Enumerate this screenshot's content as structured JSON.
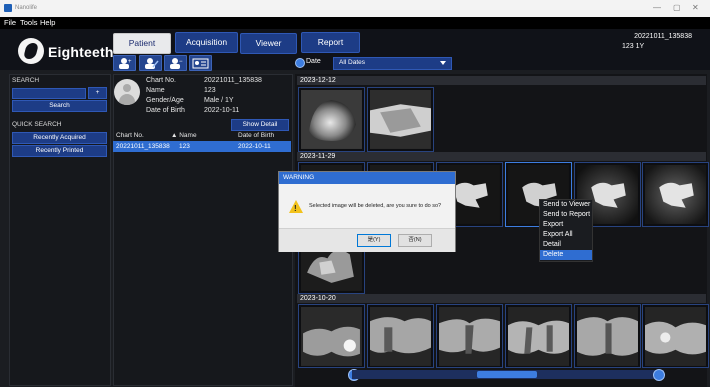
{
  "window": {
    "app_name": "Nanolife",
    "controls": [
      "—",
      "▢",
      "✕"
    ]
  },
  "menu": [
    "File",
    "Tools",
    "Help"
  ],
  "logo_text": "Eighteeth",
  "tabs": [
    {
      "label": "Patient",
      "active": true
    },
    {
      "label": "Acquisition",
      "active": false
    },
    {
      "label": "Viewer",
      "active": false
    },
    {
      "label": "Report",
      "active": false
    }
  ],
  "header_info": {
    "chart": "20221011_135838",
    "name_age": "123  1Y"
  },
  "toolbar_icons": [
    "add-patient-icon",
    "edit-patient-icon",
    "delete-patient-icon",
    "patient-card-icon"
  ],
  "date_filter": {
    "radio_label": "Date",
    "selected": "All Dates"
  },
  "sidebar": {
    "search_label": "SEARCH",
    "plus_label": "+",
    "search_button": "Search",
    "quick_label": "QUICK SEARCH",
    "recently_acquired": "Recently Acquired",
    "recently_printed": "Recently Printed"
  },
  "patient": {
    "chart_no_label": "Chart No.",
    "chart_no": "20221011_135838",
    "name_label": "Name",
    "name": "123",
    "gender_age_label": "Gender/Age",
    "gender_age": "Male / 1Y",
    "dob_label": "Date of Birth",
    "dob": "2022-10-11",
    "show_detail": "Show Detail"
  },
  "patient_list": {
    "columns": [
      "Chart No.",
      "▲ Name",
      "Date of Birth"
    ],
    "rows": [
      {
        "chart_no": "20221011_135838",
        "name": "123",
        "dob": "2022-10-11"
      }
    ]
  },
  "groups": [
    {
      "date": "2023-12-12"
    },
    {
      "date": "2023-11-29"
    },
    {
      "date": "2023-10-20"
    }
  ],
  "context_menu": [
    "Send to Viewer",
    "Send to Report",
    "Export",
    "Export All",
    "Detail",
    "Delete"
  ],
  "dialog": {
    "title": "WARNING",
    "message": "Selected image will be deleted, are you sure to do so?",
    "ok": "是(Y)",
    "cancel": "否(N)"
  },
  "colors": {
    "accent": "#2f6dd1",
    "button": "#1d3c86",
    "background": "#1b1d21"
  }
}
